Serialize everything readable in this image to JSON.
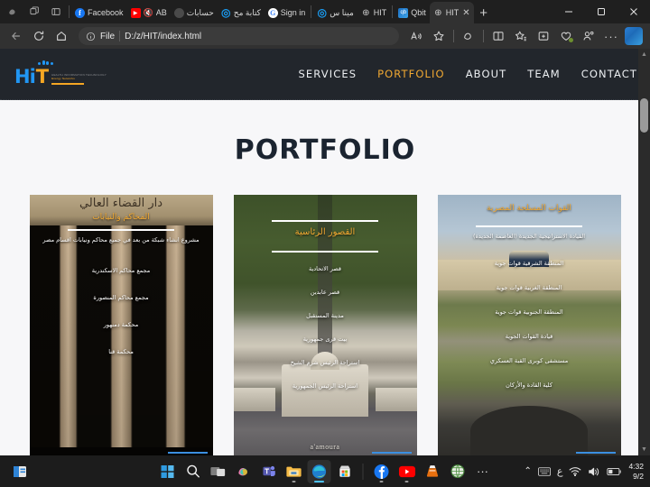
{
  "browser": {
    "window_controls": {
      "minimize": "—",
      "maximize": "❐",
      "close": "✕"
    },
    "new_tab_label": "+",
    "system_icons": [
      "copilot-icon",
      "tab-actions-icon",
      "split-screen-icon"
    ],
    "tabs": [
      {
        "title": "Facebook",
        "favicon": "facebook-icon",
        "muted": false,
        "active": false
      },
      {
        "title": "AB",
        "favicon": "youtube-icon",
        "muted": true,
        "active": false
      },
      {
        "title": "حسابات",
        "favicon": "generic-icon",
        "muted": false,
        "active": false
      },
      {
        "title": "كتابة مح",
        "favicon": "opera-icon",
        "muted": false,
        "active": false
      },
      {
        "title": "Sign in",
        "favicon": "google-icon",
        "muted": false,
        "active": false
      },
      {
        "title": "مينا س",
        "favicon": "opera-icon",
        "muted": false,
        "active": false
      },
      {
        "title": "HIT",
        "favicon": "globe-icon",
        "muted": false,
        "active": false
      },
      {
        "title": "Qbit",
        "favicon": "qbit-icon",
        "muted": false,
        "active": false
      },
      {
        "title": "HIT",
        "favicon": "globe-icon",
        "muted": false,
        "active": true
      }
    ],
    "toolbar": {
      "back": "back-icon",
      "refresh": "refresh-icon",
      "home": "home-icon",
      "info": "ⓘ",
      "scheme_label": "File",
      "url": "D:/z/HIT/index.html",
      "read_aloud": "read-aloud-icon",
      "favorite": "star-icon",
      "copilot": "copilot-icon",
      "split_screen": "split-screen-icon",
      "favorites_bar": "favorites-icon",
      "collections": "collections-icon",
      "browser_essentials": "browser-essentials-icon",
      "profile": "profile-icon",
      "settings_more": "···",
      "office": "office-icon"
    },
    "scrollbar": {
      "up_arrow": "▲",
      "down_arrow": "▼"
    }
  },
  "site": {
    "logo": {
      "text_primary": "Hi",
      "text_accent": "T",
      "tagline_line1": "HEALTH INFORMATION TECHNOLOGY",
      "tagline_line2": "Energy  Networks",
      "color_primary": "#2196f3",
      "color_accent": "#f5a623"
    },
    "nav": [
      {
        "label": "SERVICES",
        "active": false
      },
      {
        "label": "PORTFOLIO",
        "active": true
      },
      {
        "label": "ABOUT",
        "active": false
      },
      {
        "label": "TEAM",
        "active": false
      },
      {
        "label": "CONTACT",
        "active": false
      }
    ],
    "page_title": "PORTFOLIO",
    "accent_color": "#f0a832",
    "header_bg": "#22262c",
    "cards": [
      {
        "name": "courthouse-card",
        "frieze_text": "دار القضاء العالي",
        "title": "المحاكم والنيابات",
        "subtitle": "مشروع انشاء شبكة من بعد في جميع محاكم ونيابات اقسام مصر",
        "items": [
          "مجمع محاكم الاسكندرية",
          "مجمع محاكم المنصورة",
          "محكمة دمنهور",
          "محكمة قنا"
        ],
        "brand": "",
        "progress": 44
      },
      {
        "name": "palaces-card",
        "frieze_text": "",
        "title": "القصور الرئاسية",
        "subtitle": "",
        "items": [
          "قصر الاتحادية",
          "قصر عابدين",
          "مدينة المستقبل",
          "بيت قرى جمهورية",
          "استراحة الرئيس شرم الشيخ",
          "استراحة الرئيس الجمهورية"
        ],
        "brand": "a'amoura",
        "progress": 44
      },
      {
        "name": "armed-forces-card",
        "frieze_text": "",
        "title": "القوات المسلحة المصرية",
        "subtitle": "القيادة الاستراتيجية الجديدة (العاصمة الجديدة)",
        "items": [
          "المنطقة الشرقية قوات جوية",
          "المنطقة الغربية قوات جوية",
          "المنطقة الجنوبية قوات جوية",
          "قيادة القوات الجوية",
          "مستشفى كوبرى القبة العسكري",
          "كلية القادة والأركان"
        ],
        "brand": "",
        "progress": 44
      }
    ]
  },
  "taskbar": {
    "widget": "weather-widget-icon",
    "items": [
      {
        "name": "start-button",
        "icon": "windows-icon",
        "active": false,
        "running": false
      },
      {
        "name": "search-button",
        "icon": "search-icon",
        "active": false,
        "running": false
      },
      {
        "name": "task-view-button",
        "icon": "task-view-icon",
        "active": false,
        "running": false
      },
      {
        "name": "copilot-button",
        "icon": "copilot-icon",
        "active": false,
        "running": false
      },
      {
        "name": "teams-button",
        "icon": "teams-icon",
        "active": false,
        "running": false
      },
      {
        "name": "file-explorer-button",
        "icon": "folder-icon",
        "active": false,
        "running": true
      },
      {
        "name": "edge-button",
        "icon": "edge-icon",
        "active": true,
        "running": true
      },
      {
        "name": "store-button",
        "icon": "store-icon",
        "active": false,
        "running": false
      },
      {
        "name": "facebook-button",
        "icon": "facebook-icon",
        "active": false,
        "running": true
      },
      {
        "name": "youtube-button",
        "icon": "youtube-icon",
        "active": false,
        "running": true
      },
      {
        "name": "vlc-button",
        "icon": "vlc-icon",
        "active": false,
        "running": false
      },
      {
        "name": "browser-button",
        "icon": "globe-icon",
        "active": false,
        "running": false
      },
      {
        "name": "overflow-button",
        "icon": "ellipsis-icon",
        "active": false,
        "running": false
      }
    ],
    "tray": {
      "chevron": "⌃",
      "keyboard": "keyboard-icon",
      "language": "ع",
      "wifi": "wifi-icon",
      "volume": "volume-icon",
      "battery": "battery-icon",
      "time": "4:32",
      "date": "9/2"
    }
  }
}
